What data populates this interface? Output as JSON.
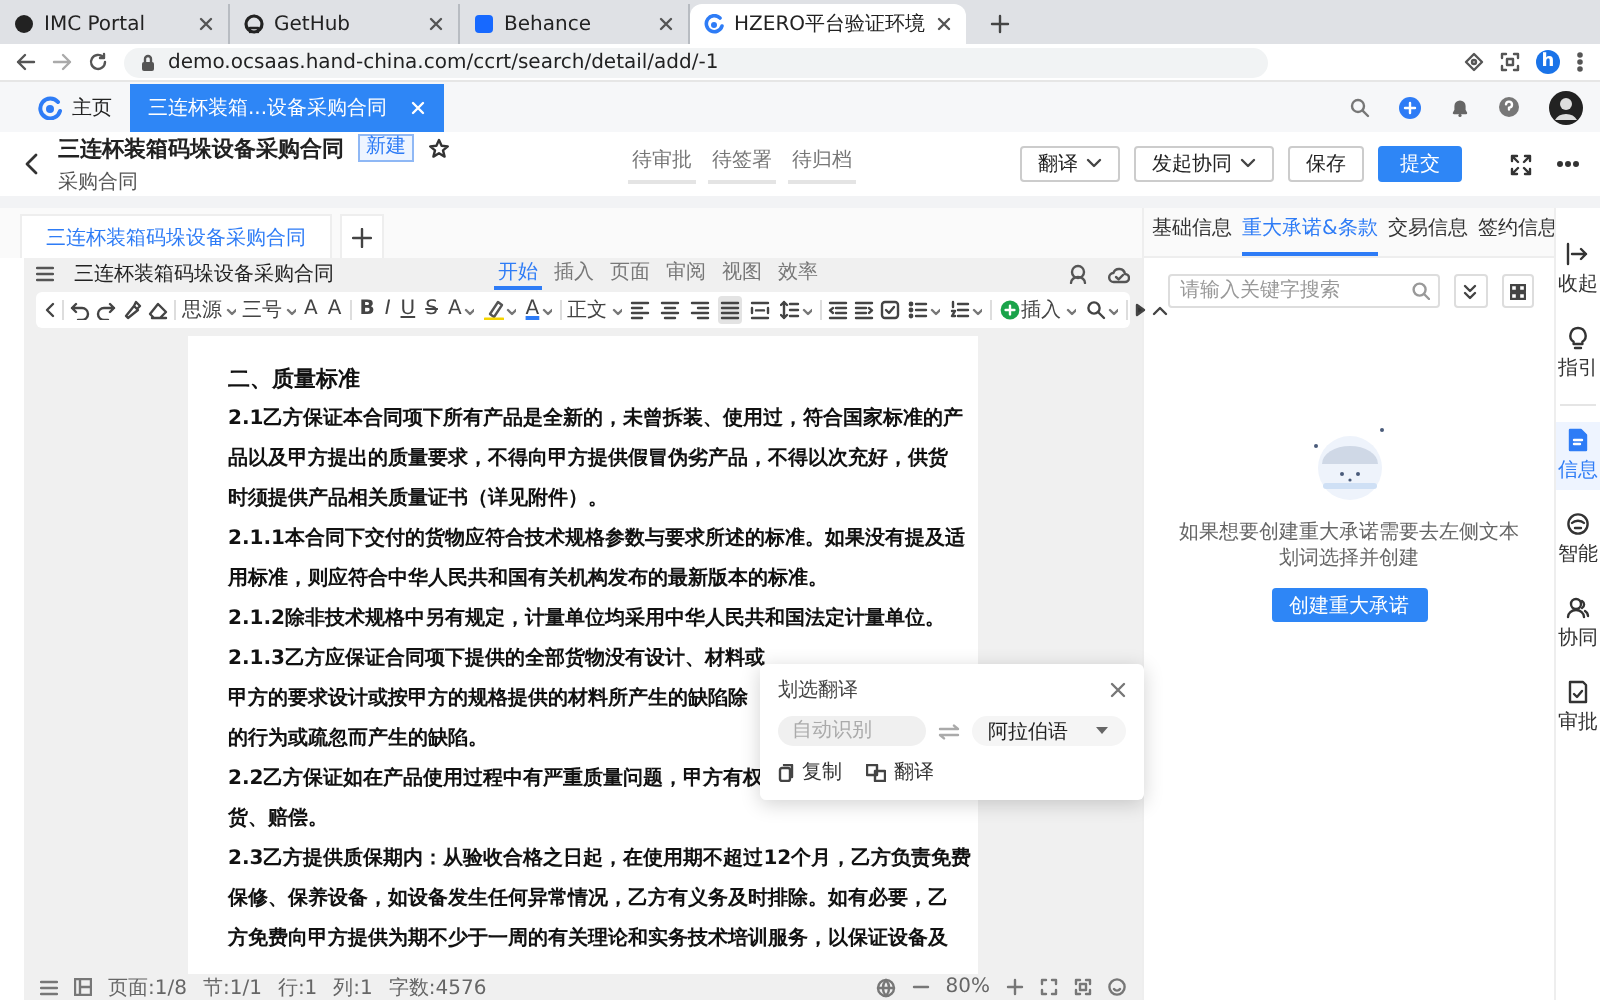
{
  "browser": {
    "tabs": [
      {
        "title": "IMC Portal",
        "kind": "dot",
        "selected": false
      },
      {
        "title": "GetHub",
        "kind": "ring",
        "selected": false
      },
      {
        "title": "Behance",
        "kind": "square",
        "selected": false
      },
      {
        "title": "HZERO平台验证环境",
        "kind": "logo",
        "selected": true
      }
    ],
    "url": "demo.ocsaas.hand-china.com/ccrt/search/detail/add/-1",
    "profile_initial": "h"
  },
  "app_tabs": [
    {
      "label": "主页",
      "kind": "home",
      "selected": false
    },
    {
      "label": "三连杯装箱...设备采购合同",
      "kind": "page",
      "selected": true
    }
  ],
  "record": {
    "title": "三连杯装箱码垛设备采购合同",
    "badge": "新建",
    "subtitle": "采购合同",
    "starred": false,
    "steps": [
      "待审批",
      "待签署",
      "待归档"
    ],
    "buttons": [
      {
        "label": "翻译",
        "kind": "dropdown"
      },
      {
        "label": "发起协同",
        "kind": "dropdown"
      },
      {
        "label": "保存",
        "kind": "default"
      },
      {
        "label": "提交",
        "kind": "primary"
      }
    ]
  },
  "document_tabs": [
    {
      "label": "三连杯装箱码垛设备采购合同",
      "selected": true
    }
  ],
  "editor": {
    "doc_name": "三连杯装箱码垛设备采购合同",
    "menu_tabs": [
      {
        "label": "开始",
        "selected": true
      },
      {
        "label": "插入",
        "selected": false
      },
      {
        "label": "页面",
        "selected": false
      },
      {
        "label": "审阅",
        "selected": false
      },
      {
        "label": "视图",
        "selected": false
      },
      {
        "label": "效率",
        "selected": false
      }
    ],
    "toolbar": {
      "font": "思源",
      "size": "三号",
      "grow_shrink": [
        "A",
        "A"
      ],
      "text_styles": [
        "B",
        "I",
        "U",
        "S",
        "A"
      ],
      "font_color": "A",
      "paragraph_style": "正文",
      "insert": "插入",
      "alignment": [
        {
          "kind": "left",
          "selected": false
        },
        {
          "kind": "center",
          "selected": false
        },
        {
          "kind": "right",
          "selected": false
        },
        {
          "kind": "justify",
          "selected": true
        },
        {
          "kind": "distribute",
          "selected": false
        }
      ]
    },
    "lines": [
      {
        "kind": "heading",
        "text": "二、质量标准"
      },
      {
        "kind": "body",
        "text": "2.1乙方保证本合同项下所有产品是全新的，未曾拆装、使用过，符合国家标准的产"
      },
      {
        "kind": "body",
        "text": "品以及甲方提出的质量要求，不得向甲方提供假冒伪劣产品，不得以次充好，供货"
      },
      {
        "kind": "body",
        "text": "时须提供产品相关质量证书（详见附件）。"
      },
      {
        "kind": "body",
        "text": "2.1.1本合同下交付的货物应符合技术规格参数与要求所述的标准。如果没有提及适"
      },
      {
        "kind": "body",
        "text": "用标准，则应符合中华人民共和国有关机构发布的最新版本的标准。"
      },
      {
        "kind": "body",
        "text": "2.1.2除非技术规格中另有规定，计量单位均采用中华人民共和国法定计量单位。"
      },
      {
        "kind": "body",
        "text": "2.1.3乙方应保证合同项下提供的全部货物没有设计、材料或"
      },
      {
        "kind": "body",
        "text": "甲方的要求设计或按甲方的规格提供的材料所产生的缺陷除"
      },
      {
        "kind": "body",
        "text": "的行为或疏忽而产生的缺陷。"
      },
      {
        "kind": "body",
        "text": "2.2乙方保证如在产品使用过程中有严重质量问题，甲方有权"
      },
      {
        "kind": "body",
        "text": "货、赔偿。"
      },
      {
        "kind": "body",
        "text": "2.3乙方提供质保期内：从验收合格之日起，在使用期不超过12个月，乙方负责免费"
      },
      {
        "kind": "body",
        "text": "保修、保养设备，如设备发生任何异常情况，乙方有义务及时排除。如有必要，乙"
      },
      {
        "kind": "body",
        "text": "方免费向甲方提供为期不少于一周的有关理论和实务技术培训服务，以保证设备及"
      }
    ],
    "status": [
      "页面:1/8",
      "节:1/1",
      "行:1",
      "列:1",
      "字数:4576"
    ],
    "zoom": "80%"
  },
  "translate_popup": {
    "title": "划选翻译",
    "source": {
      "placeholder": "自动识别"
    },
    "target": {
      "value": "阿拉伯语"
    },
    "actions": [
      {
        "label": "复制",
        "kind": "copy"
      },
      {
        "label": "翻译",
        "kind": "translate"
      }
    ]
  },
  "side_panel": {
    "tabs": [
      {
        "label": "基础信息",
        "selected": false
      },
      {
        "label": "重大承诺&条款",
        "selected": true
      },
      {
        "label": "交易信息",
        "selected": false
      },
      {
        "label": "签约信息",
        "selected": false
      }
    ],
    "search": {
      "placeholder": "请输入关键字搜索"
    },
    "empty_message": "如果想要创建重大承诺需要去左侧文本划词选择并创建",
    "create_button": "创建重大承诺"
  },
  "side_rail": [
    {
      "label": "收起",
      "kind": "collapse",
      "selected": false
    },
    {
      "label": "指引",
      "kind": "guide",
      "selected": false
    },
    {
      "label": "信息",
      "kind": "info",
      "selected": true
    },
    {
      "label": "智能",
      "kind": "smart",
      "selected": false
    },
    {
      "label": "协同",
      "kind": "collab",
      "selected": false
    },
    {
      "label": "审批",
      "kind": "approve",
      "selected": false
    }
  ]
}
